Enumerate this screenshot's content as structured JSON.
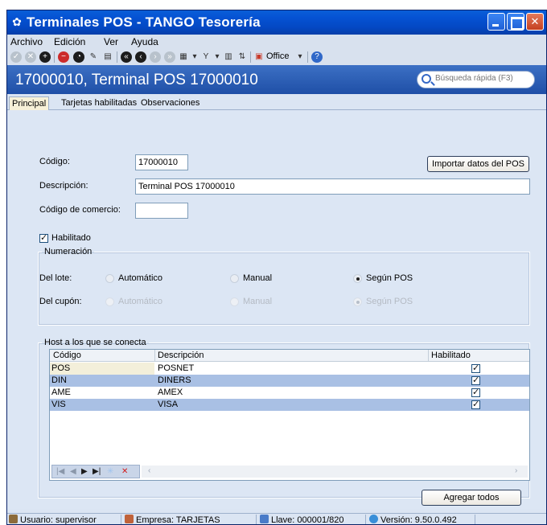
{
  "window": {
    "title": "Terminales POS - TANGO Tesorería"
  },
  "menu": [
    "Archivo",
    "Edición",
    "Ver",
    "Ayuda"
  ],
  "toolbar": {
    "office_label": "Office"
  },
  "header": {
    "title": "17000010, Terminal POS 17000010",
    "search_placeholder": "Búsqueda rápida (F3)"
  },
  "tabs": [
    "Principal",
    "Tarjetas habilitadas",
    "Observaciones"
  ],
  "form": {
    "codigo_label": "Código:",
    "codigo_value": "17000010",
    "import_button": "Importar datos del POS",
    "descripcion_label": "Descripción:",
    "descripcion_value": "Terminal POS 17000010",
    "comercio_label": "Código de comercio:",
    "comercio_value": "",
    "habilitado_label": "Habilitado",
    "habilitado_checked": true
  },
  "numeracion": {
    "legend": "Numeración",
    "lote_label": "Del lote:",
    "cupon_label": "Del cupón:",
    "options": [
      "Automático",
      "Manual",
      "Según POS"
    ],
    "lote_selected": "Según POS",
    "cupon_selected": "Según POS"
  },
  "hosts": {
    "legend": "Host a los que se conecta",
    "columns": [
      "Código",
      "Descripción",
      "Habilitado"
    ],
    "rows": [
      {
        "codigo": "POS",
        "descripcion": "POSNET",
        "habilitado": true
      },
      {
        "codigo": "DIN",
        "descripcion": "DINERS",
        "habilitado": true
      },
      {
        "codigo": "AME",
        "descripcion": "AMEX",
        "habilitado": true
      },
      {
        "codigo": "VIS",
        "descripcion": "VISA",
        "habilitado": true
      }
    ],
    "add_all_button": "Agregar todos"
  },
  "status": {
    "usuario": "Usuario: supervisor",
    "empresa": "Empresa: TARJETAS",
    "llave": "Llave: 000001/820",
    "version": "Versión: 9.50.0.492"
  },
  "colors": {
    "titlebar": "#0552d3",
    "header": "#2b5db5",
    "row_highlight": "#a9c0e4",
    "active_tab": "#f7f1d8"
  }
}
